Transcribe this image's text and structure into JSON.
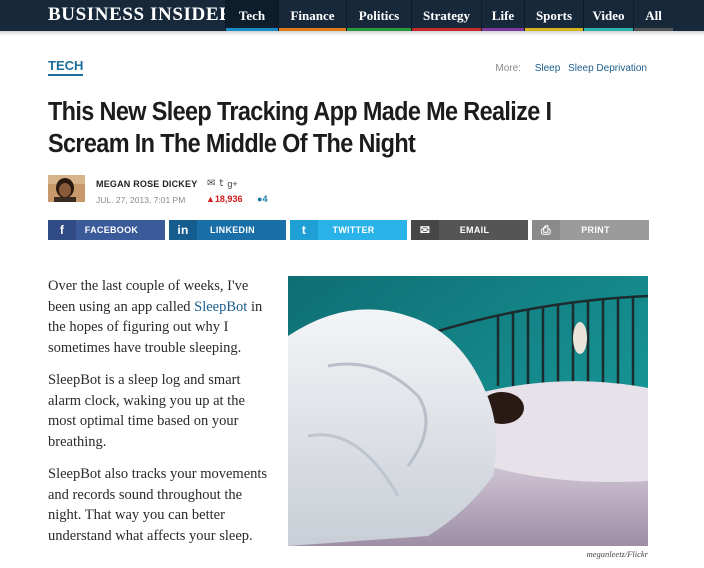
{
  "site": {
    "logo": "BUSINESS INSIDER"
  },
  "nav": {
    "items": [
      {
        "label": "Tech",
        "color": "#1a8bc4",
        "active": true
      },
      {
        "label": "Finance",
        "color": "#e37b1c"
      },
      {
        "label": "Politics",
        "color": "#2a9a3a"
      },
      {
        "label": "Strategy",
        "color": "#c8282a"
      },
      {
        "label": "Life",
        "color": "#7f3b9c"
      },
      {
        "label": "Sports",
        "color": "#d8b41c"
      },
      {
        "label": "Video",
        "color": "#2bb3a8"
      },
      {
        "label": "All",
        "color": "#555555"
      }
    ]
  },
  "section": {
    "tag": "TECH",
    "more_label": "More:",
    "more_links": [
      "Sleep",
      "Sleep Deprivation"
    ]
  },
  "article": {
    "headline": "This New Sleep Tracking App Made Me Realize I Scream In The Middle Of The Night",
    "author": "MEGAN ROSE DICKEY",
    "date": "JUL. 27, 2013, 7:01 PM",
    "views": "18,936",
    "comments": "4",
    "paragraphs": [
      {
        "before": "Over the last couple of weeks, I've been using an app called ",
        "link": "SleepBot",
        "after": " in the hopes of figuring out why I sometimes have trouble sleeping."
      },
      {
        "before": "SleepBot is a sleep log and smart alarm clock, waking you up at the most optimal time based on your breathing.",
        "link": "",
        "after": ""
      },
      {
        "before": "SleepBot also tracks your movements and records sound throughout the night. That way you can better understand what affects your sleep.",
        "link": "",
        "after": ""
      }
    ],
    "photo_credit": "meganleetz/Flickr"
  },
  "share": {
    "buttons": [
      {
        "label": "FACEBOOK",
        "icon": "facebook-icon",
        "glyph": "f",
        "bg": "#3b5a9a",
        "icbg": "#2f4a84"
      },
      {
        "label": "LINKEDIN",
        "icon": "linkedin-icon",
        "glyph": "in",
        "bg": "#1b6fa8",
        "icbg": "#155d8f"
      },
      {
        "label": "TWITTER",
        "icon": "twitter-icon",
        "glyph": "t",
        "bg": "#2ab3e8",
        "icbg": "#1fa0d4"
      },
      {
        "label": "EMAIL",
        "icon": "email-icon",
        "glyph": "✉",
        "bg": "#555555",
        "icbg": "#464646"
      },
      {
        "label": "PRINT",
        "icon": "print-icon",
        "glyph": "⎙",
        "bg": "#9b9b9b",
        "icbg": "#8a8a8a"
      }
    ]
  }
}
